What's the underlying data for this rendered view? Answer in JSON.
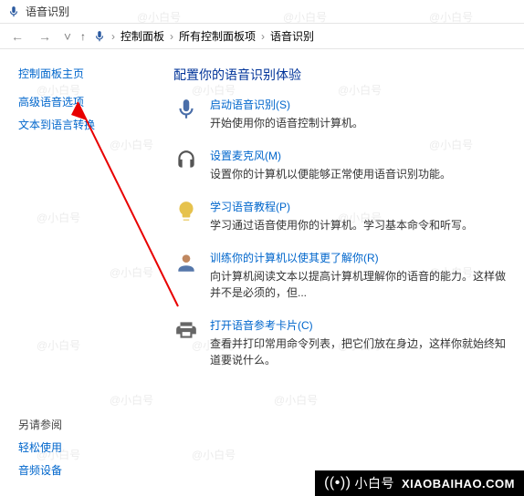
{
  "titlebar": {
    "title": "语音识别"
  },
  "breadcrumb": {
    "root": "控制面板",
    "sub": "所有控制面板项",
    "leaf": "语音识别"
  },
  "sidebar": {
    "home": "控制面板主页",
    "links": [
      "高级语音选项",
      "文本到语言转换"
    ],
    "see_also_title": "另请参阅",
    "see_also": [
      "轻松使用",
      "音频设备"
    ]
  },
  "main": {
    "title": "配置你的语音识别体验",
    "items": [
      {
        "link": "启动语音识别(S)",
        "desc": "开始使用你的语音控制计算机。"
      },
      {
        "link": "设置麦克风(M)",
        "desc": "设置你的计算机以便能够正常使用语音识别功能。"
      },
      {
        "link": "学习语音教程(P)",
        "desc": "学习通过语音使用你的计算机。学习基本命令和听写。"
      },
      {
        "link": "训练你的计算机以使其更了解你(R)",
        "desc": "向计算机阅读文本以提高计算机理解你的语音的能力。这样做并不是必须的，但..."
      },
      {
        "link": "打开语音参考卡片(C)",
        "desc": "查看并打印常用命令列表，把它们放在身边，这样你就始终知道要说什么。"
      }
    ]
  },
  "watermark": {
    "logo": "小白号",
    "url": "XIAOBAIHAO.COM",
    "faint": "@小白号"
  }
}
